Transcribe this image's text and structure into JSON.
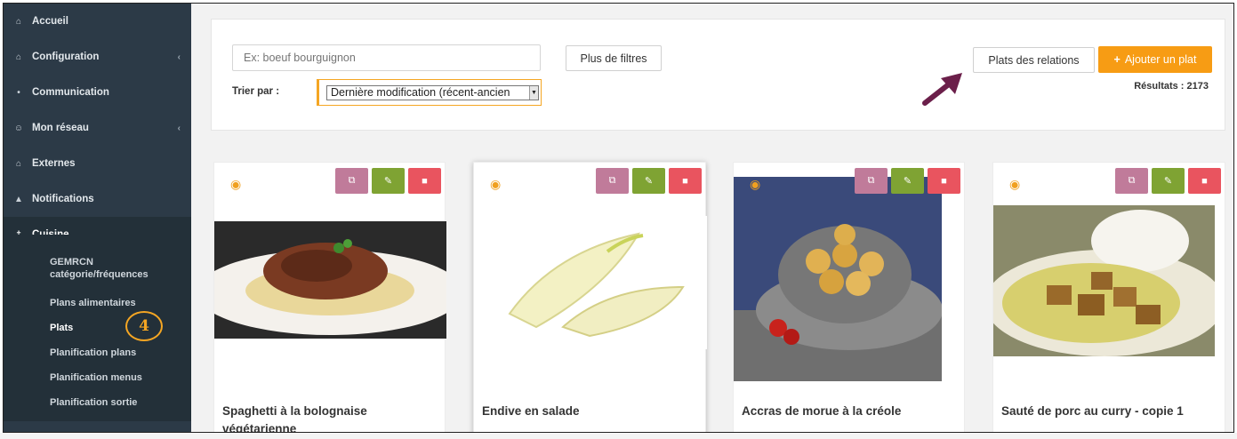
{
  "sidebar": {
    "items": [
      {
        "label": "Accueil",
        "icon": "home-icon",
        "glyph": "⌂"
      },
      {
        "label": "Configuration",
        "icon": "institution-icon",
        "glyph": "⌂",
        "chevron": "‹"
      },
      {
        "label": "Communication",
        "icon": "chat-icon",
        "glyph": "•"
      },
      {
        "label": "Mon réseau",
        "icon": "users-icon",
        "glyph": "☺",
        "chevron": "‹"
      },
      {
        "label": "Externes",
        "icon": "home-icon",
        "glyph": "⌂"
      },
      {
        "label": "Notifications",
        "icon": "bell-icon",
        "glyph": "▲"
      },
      {
        "label": "Cuisine",
        "icon": "cutlery-icon",
        "glyph": "†",
        "chevron": "⌄"
      }
    ],
    "submenu": [
      {
        "label": "GEMRCN catégorie/fréquences"
      },
      {
        "label": "Plans alimentaires"
      },
      {
        "label": "Plats"
      },
      {
        "label": "Planification plans"
      },
      {
        "label": "Planification menus"
      },
      {
        "label": "Planification sortie"
      }
    ],
    "annotation_number": "4"
  },
  "toolbar": {
    "search_placeholder": "Ex: boeuf bourguignon",
    "filters_label": "Plus de filtres",
    "sort_label": "Trier par :",
    "sort_value": "Dernière modification (récent-ancien",
    "relations_label": "Plats des relations",
    "add_label": "Ajouter un plat",
    "results_text": "Résultats : 2173"
  },
  "cards": [
    {
      "title": "Spaghetti à la bolognaise végétarienne",
      "image": "spaghetti-bolognese"
    },
    {
      "title": "Endive en salade",
      "image": "endive"
    },
    {
      "title": "Accras de morue à la créole",
      "image": "accras"
    },
    {
      "title": "Sauté de porc au curry - copie 1",
      "image": "pork-curry"
    }
  ],
  "colors": {
    "sidebar_bg": "#2c3a47",
    "accent_orange": "#f79c14",
    "copy_button": "#c07b9a",
    "edit_button": "#7fa333",
    "delete_button": "#e9545f",
    "arrow": "#6b1f4a"
  }
}
